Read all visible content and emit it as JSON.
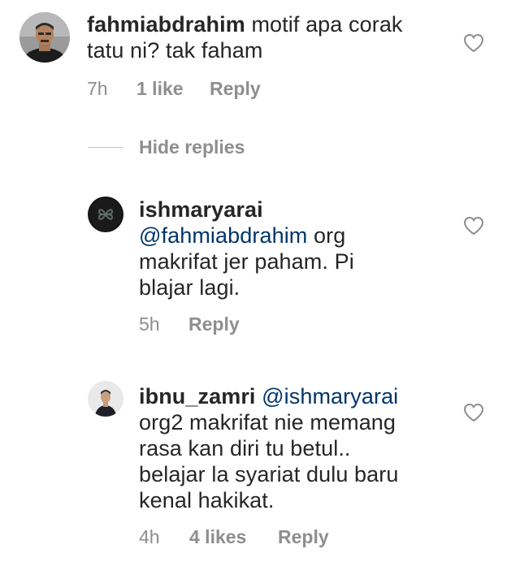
{
  "comments": [
    {
      "username": "fahmiabdrahim",
      "lines": [
        "motif apa corak",
        "tatu ni? tak faham"
      ],
      "time": "7h",
      "likes": "1 like",
      "reply": "Reply",
      "heart_icon": "heart-outline-icon"
    },
    {
      "username": "ishmaryarai",
      "mention": "@fahmiabdrahim",
      "lines": [
        "org",
        "makrifat jer paham.  Pi",
        "blajar lagi."
      ],
      "time": "5h",
      "reply": "Reply",
      "heart_icon": "heart-outline-icon"
    },
    {
      "username": "ibnu_zamri",
      "mention": "@ishmaryarai",
      "lines": [
        "org2 makrifat nie memang",
        "rasa kan diri tu betul..",
        "belajar la syariat dulu baru",
        "kenal hakikat."
      ],
      "time": "4h",
      "likes": "4 likes",
      "reply": "Reply",
      "heart_icon": "heart-outline-icon"
    }
  ],
  "hide_replies": "Hide replies",
  "colors": {
    "text": "#262626",
    "meta": "#8e8e8e",
    "mention": "#003569",
    "divider": "#c7c7c7"
  }
}
